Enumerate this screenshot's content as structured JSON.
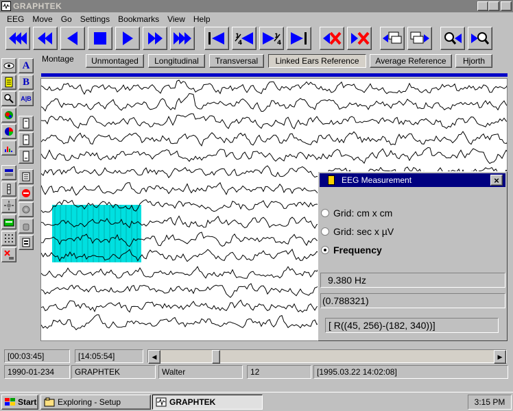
{
  "window": {
    "title": "GRAPHTEK"
  },
  "menu": [
    "EEG",
    "Move",
    "Go",
    "Settings",
    "Bookmarks",
    "View",
    "Help"
  ],
  "toolbar": {
    "icons": [
      "fast-rewind-icon",
      "rewind-icon",
      "play-backward-icon",
      "stop-icon",
      "play-forward-icon",
      "fast-forward-icon",
      "fastest-forward-icon",
      "go-to-start-icon",
      "quarter-back-icon",
      "quarter-forward-icon",
      "go-to-end-icon",
      "delete-back-icon",
      "delete-forward-icon",
      "copy-pages-left-icon",
      "copy-pages-right-icon",
      "zoom-back-icon",
      "zoom-forward-icon"
    ],
    "colors": {
      "blue": "#0000ff",
      "red": "#ff0000"
    }
  },
  "palette": {
    "letter_a": "A",
    "letter_b": "B",
    "letter_ab": "A|B"
  },
  "montage": {
    "label": "Montage",
    "buttons": [
      "Unmontaged",
      "Longitudinal",
      "Transversal",
      "Linked Ears Reference",
      "Average Reference",
      "Hjorth"
    ],
    "active": "Linked Ears Reference"
  },
  "measurement": {
    "title": "EEG Measurement",
    "close": "×",
    "options": [
      "Grid: cm x cm",
      "Grid: sec x µV",
      "Frequency"
    ],
    "selected": "Frequency",
    "frequency_value": "9.380 Hz",
    "ratio_value": "(0.788321)",
    "region_value": "[ R((45, 256)-(182, 340))]"
  },
  "status": {
    "elapsed": "[00:03:45]",
    "clock_time": "[14:05:54]",
    "record_id": "1990-01-234",
    "program": "GRAPHTEK",
    "user": "Walter",
    "channels": "12",
    "recorded": "[1995.03.22 14:02:08]",
    "scroll_left": "◀",
    "scroll_right": "▶"
  },
  "taskbar": {
    "start": "Start",
    "tasks": [
      "Exploring - Setup",
      "GRAPHTEK"
    ],
    "active_task": "GRAPHTEK",
    "clock": "3:15 PM"
  },
  "selection_color": "#00e0e0"
}
